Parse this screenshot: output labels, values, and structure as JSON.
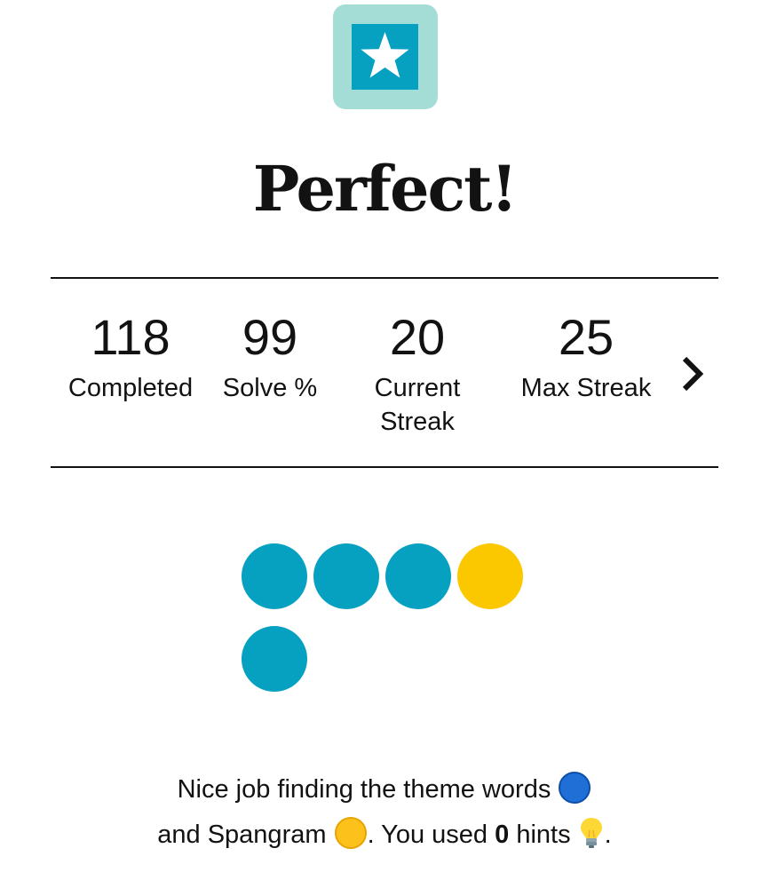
{
  "badge": {
    "icon": "star-icon",
    "outer_color": "#a3ddd5",
    "inner_color": "#06a0c1"
  },
  "result": {
    "title": "Perfect!"
  },
  "stats": [
    {
      "value": "118",
      "label": "Completed"
    },
    {
      "value": "99",
      "label": "Solve %"
    },
    {
      "value": "20",
      "label": "Current Streak"
    },
    {
      "value": "25",
      "label": "Max Streak"
    }
  ],
  "stats_next_icon": "chevron-right-icon",
  "progress_dots": [
    {
      "type": "theme",
      "color": "#06a0c1"
    },
    {
      "type": "theme",
      "color": "#06a0c1"
    },
    {
      "type": "theme",
      "color": "#06a0c1"
    },
    {
      "type": "spangram",
      "color": "#fbc800"
    },
    {
      "type": "theme",
      "color": "#06a0c1"
    }
  ],
  "message": {
    "part1": "Nice job finding the theme words",
    "theme_icon": "blue-circle-icon",
    "part2": "and Spangram",
    "spangram_icon": "yellow-circle-icon",
    "part3": ". You used",
    "hints_count": "0",
    "part4": "hints",
    "hint_icon": "lightbulb-icon",
    "part5": "."
  }
}
